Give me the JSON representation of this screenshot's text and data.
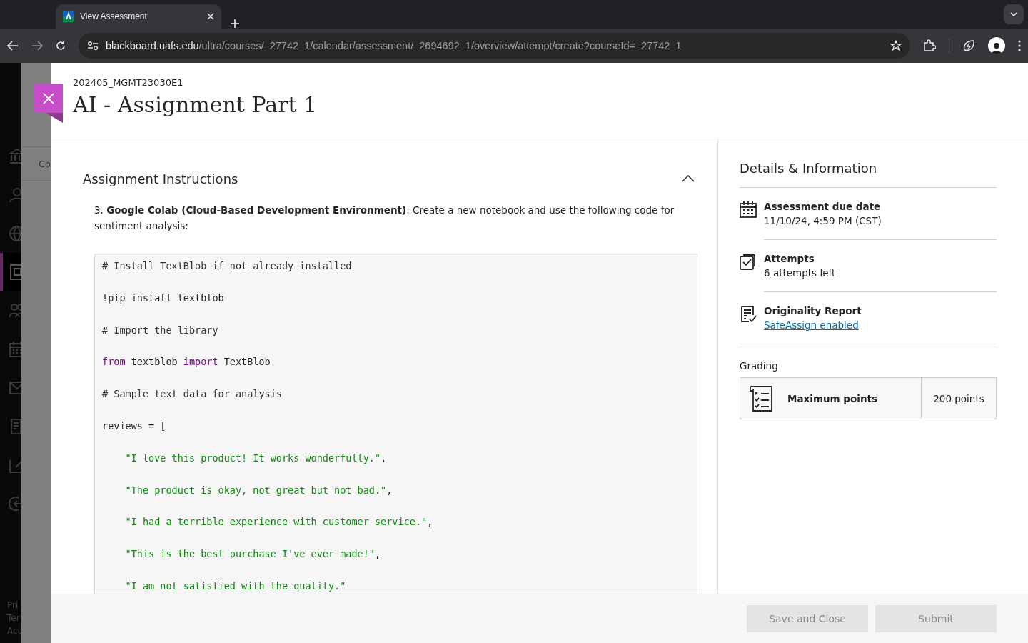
{
  "browser": {
    "tab": {
      "title": "View Assessment"
    },
    "url": {
      "host": "blackboard.uafs.edu",
      "path": "/ultra/courses/_27742_1/calendar/assessment/_2694692_1/overview/attempt/create?courseId=_27742_1"
    }
  },
  "nav": {
    "items": [
      {
        "kind": "institution",
        "selected": false
      },
      {
        "kind": "profile",
        "selected": false
      },
      {
        "kind": "globe",
        "selected": false
      },
      {
        "kind": "courses",
        "selected": true
      },
      {
        "kind": "groups",
        "selected": false
      },
      {
        "kind": "calendar",
        "selected": false
      },
      {
        "kind": "messages",
        "selected": false
      },
      {
        "kind": "grades",
        "selected": false
      },
      {
        "kind": "tools",
        "selected": false
      },
      {
        "kind": "signout",
        "selected": false
      }
    ],
    "footer_links": [
      "Pri",
      "Ter",
      "Acc"
    ]
  },
  "background_page": {
    "tab_fragment": "Co"
  },
  "panel": {
    "course_id": "202405_MGMT23030E1",
    "title": "AI - Assignment Part 1",
    "instructions": {
      "heading": "Assignment Instructions",
      "expanded": true,
      "intro": "3. **Google Colab (Cloud-Based Development Environment)**: Create a new notebook and use the following code for sentiment analysis:",
      "code_lines": [
        [
          {
            "kind": "comment",
            "text": "# Install TextBlob if not already installed"
          }
        ],
        [
          {
            "kind": "plain",
            "text": "!pip install textblob"
          }
        ],
        [
          {
            "kind": "comment",
            "text": "# Import the library"
          }
        ],
        [
          {
            "kind": "keyword",
            "text": "from"
          },
          {
            "kind": "plain",
            "text": " textblob "
          },
          {
            "kind": "keyword",
            "text": "import"
          },
          {
            "kind": "plain",
            "text": " TextBlob"
          }
        ],
        [
          {
            "kind": "comment",
            "text": "# Sample text data for analysis"
          }
        ],
        [
          {
            "kind": "plain",
            "text": "reviews = ["
          }
        ],
        [
          {
            "kind": "string",
            "indent": true,
            "text": "\"I love this product! It works wonderfully.\""
          },
          {
            "kind": "plain",
            "text": ","
          }
        ],
        [
          {
            "kind": "string",
            "indent": true,
            "text": "\"The product is okay, not great but not bad.\""
          },
          {
            "kind": "plain",
            "text": ","
          }
        ],
        [
          {
            "kind": "string",
            "indent": true,
            "text": "\"I had a terrible experience with customer service.\""
          },
          {
            "kind": "plain",
            "text": ","
          }
        ],
        [
          {
            "kind": "string",
            "indent": true,
            "text": "\"This is the best purchase I've ever made!\""
          },
          {
            "kind": "plain",
            "text": ","
          }
        ],
        [
          {
            "kind": "string",
            "indent": true,
            "text": "\"I am not satisfied with the quality.\""
          }
        ]
      ]
    },
    "details": {
      "heading": "Details & Information",
      "items": [
        {
          "kind": "calendar",
          "label": "Assessment due date",
          "value": "11/10/24, 4:59 PM (CST)"
        },
        {
          "kind": "attempts",
          "label": "Attempts",
          "value": "6 attempts left"
        },
        {
          "kind": "report",
          "label": "Originality Report",
          "link": "SafeAssign enabled"
        }
      ],
      "grading": {
        "heading": "Grading",
        "label": "Maximum points",
        "value": "200 points"
      }
    },
    "buttons": [
      {
        "label": "Save and Close",
        "disabled": true
      },
      {
        "label": "Submit",
        "disabled": true
      }
    ]
  }
}
